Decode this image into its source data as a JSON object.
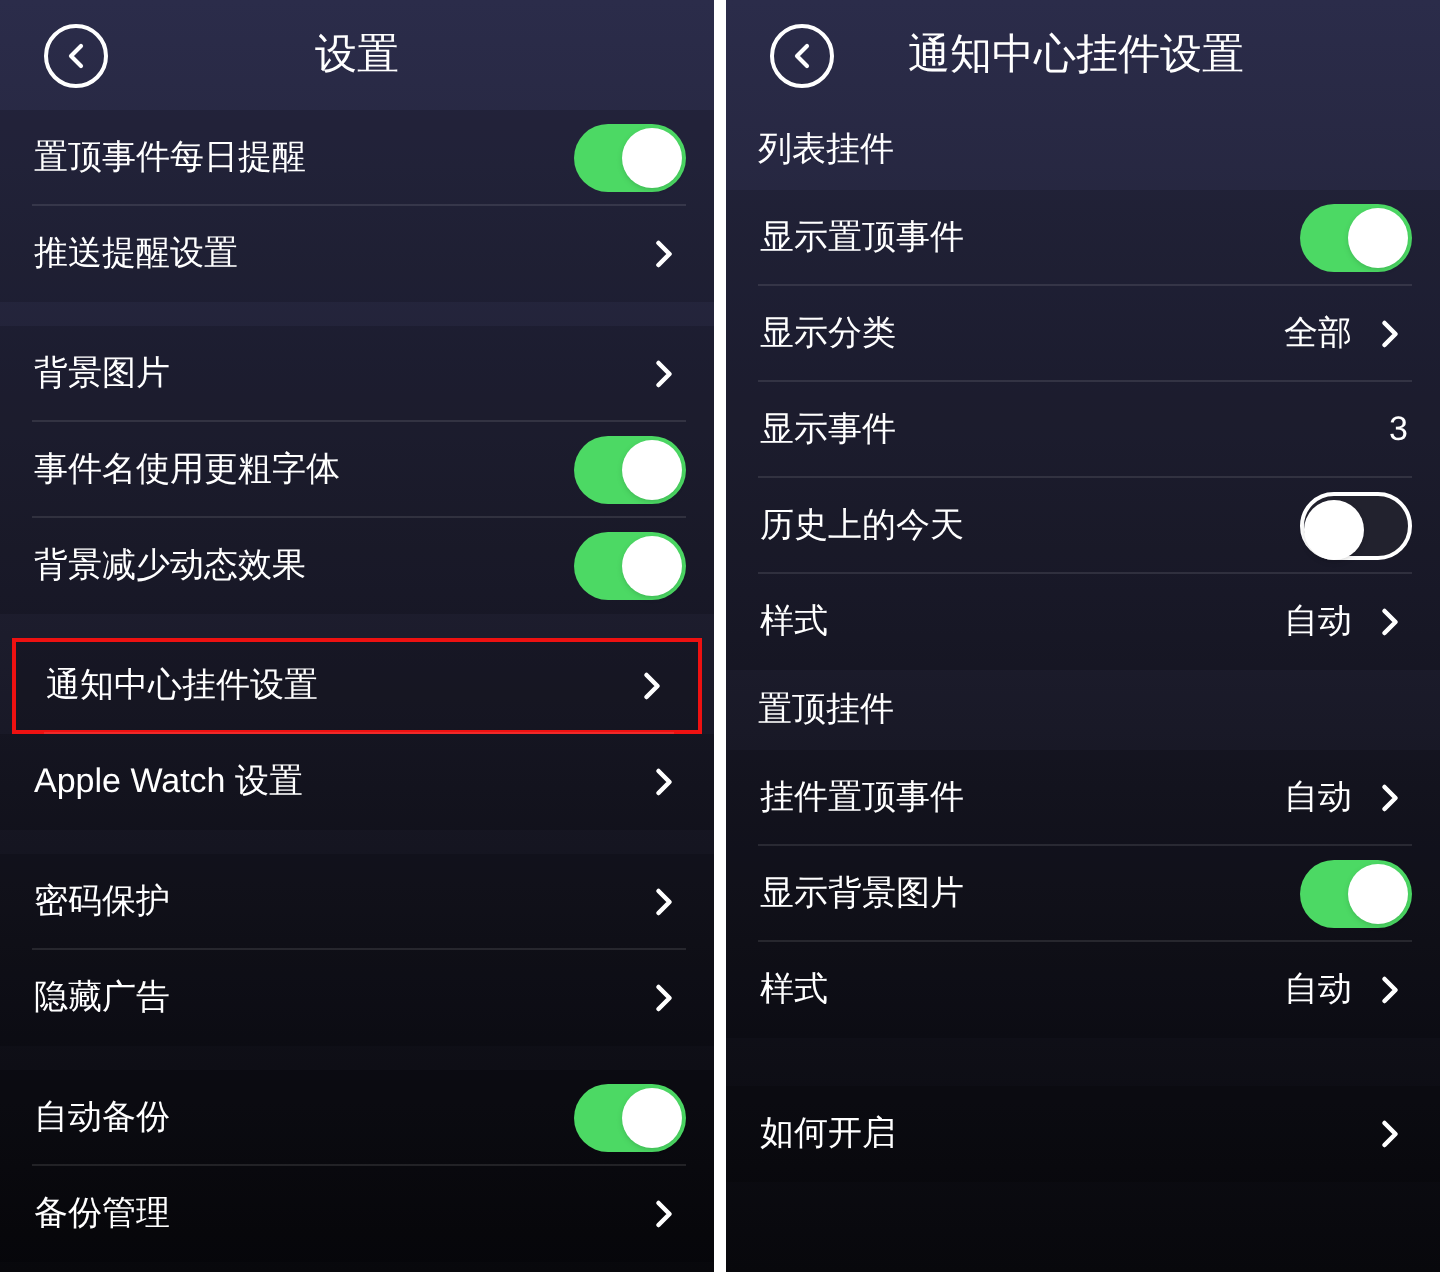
{
  "panels": [
    {
      "title": "设置",
      "groups": [
        {
          "items": [
            {
              "kind": "toggle",
              "label": "置顶事件每日提醒",
              "on": true
            },
            {
              "kind": "link",
              "label": "推送提醒设置"
            }
          ]
        },
        {
          "items": [
            {
              "kind": "link",
              "label": "背景图片"
            },
            {
              "kind": "toggle",
              "label": "事件名使用更粗字体",
              "on": true
            },
            {
              "kind": "toggle",
              "label": "背景减少动态效果",
              "on": true
            }
          ]
        },
        {
          "items": [
            {
              "kind": "link",
              "label": "通知中心挂件设置",
              "highlighted": true
            },
            {
              "kind": "link",
              "label": "Apple Watch 设置",
              "highlighted": false
            }
          ]
        },
        {
          "items": [
            {
              "kind": "link",
              "label": "密码保护"
            },
            {
              "kind": "link",
              "label": "隐藏广告"
            }
          ]
        },
        {
          "items": [
            {
              "kind": "toggle",
              "label": "自动备份",
              "on": true
            },
            {
              "kind": "link",
              "label": "备份管理"
            }
          ]
        }
      ]
    },
    {
      "title": "通知中心挂件设置",
      "groups": [
        {
          "header": "列表挂件",
          "items": [
            {
              "kind": "toggle",
              "label": "显示置顶事件",
              "on": true
            },
            {
              "kind": "link",
              "label": "显示分类",
              "value": "全部"
            },
            {
              "kind": "value",
              "label": "显示事件",
              "value": "3"
            },
            {
              "kind": "toggle",
              "label": "历史上的今天",
              "on": false
            },
            {
              "kind": "link",
              "label": "样式",
              "value": "自动"
            }
          ]
        },
        {
          "header": "置顶挂件",
          "items": [
            {
              "kind": "link",
              "label": "挂件置顶事件",
              "value": "自动"
            },
            {
              "kind": "toggle",
              "label": "显示背景图片",
              "on": true
            },
            {
              "kind": "link",
              "label": "样式",
              "value": "自动"
            }
          ]
        },
        {
          "items": [
            {
              "kind": "link",
              "label": "如何开启"
            }
          ]
        }
      ]
    }
  ]
}
